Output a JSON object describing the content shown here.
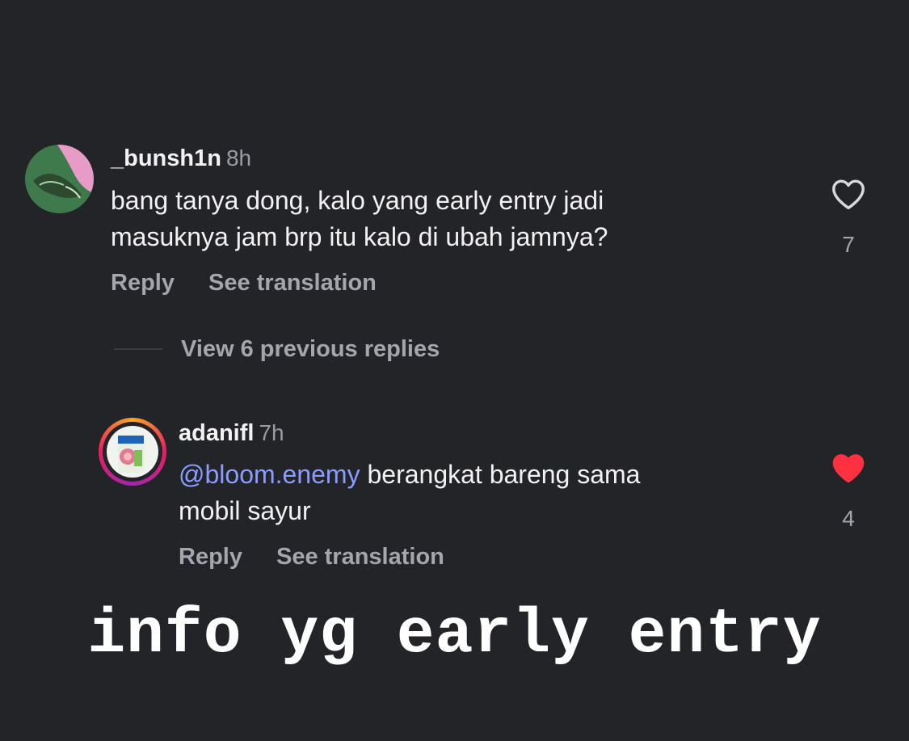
{
  "comment1": {
    "username": "_bunsh1n",
    "time": "8h",
    "text_line1": "bang tanya dong, kalo yang early entry jadi",
    "text_line2": "masuknya jam brp itu kalo di ubah jamnya?",
    "reply_label": "Reply",
    "translate_label": "See translation",
    "like_icon": "heart-outline-icon",
    "like_count": "7"
  },
  "view_replies": "View 6 previous replies",
  "comment2": {
    "username": "adanifl",
    "time": "7h",
    "mention": "@bloom.enemy",
    "text_rest": " berangkat bareng sama",
    "text_line2": "mobil sayur",
    "reply_label": "Reply",
    "translate_label": "See translation",
    "like_icon": "heart-filled-icon",
    "like_color": "#ff3040",
    "like_count": "4"
  },
  "caption": "info yg early entry",
  "colors": {
    "background": "#232428",
    "mention": "#8a9dff",
    "muted": "#a4a6ac"
  }
}
